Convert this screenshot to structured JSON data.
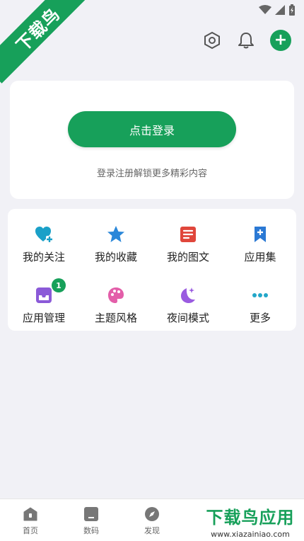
{
  "watermark": {
    "corner_text": "下载鸟",
    "logo_title": "下载鸟应用",
    "logo_url": "www.xiazainiao.com"
  },
  "login": {
    "button_label": "点击登录",
    "hint": "登录注册解锁更多精彩内容"
  },
  "menu": [
    {
      "label": "我的关注",
      "icon": "heart-plus-icon",
      "color": "#1aa0c8"
    },
    {
      "label": "我的收藏",
      "icon": "star-icon",
      "color": "#2a87d9"
    },
    {
      "label": "我的图文",
      "icon": "document-icon",
      "color": "#e0463b"
    },
    {
      "label": "应用集",
      "icon": "bookmark-plus-icon",
      "color": "#2b79d4"
    },
    {
      "label": "应用管理",
      "icon": "tray-icon",
      "color": "#8b5ad8",
      "badge": "1"
    },
    {
      "label": "主题风格",
      "icon": "palette-icon",
      "color": "#e35ea9"
    },
    {
      "label": "夜间模式",
      "icon": "moon-icon",
      "color": "#9a5be0"
    },
    {
      "label": "更多",
      "icon": "more-dots-icon",
      "color": "#23a7c9"
    }
  ],
  "bottom_nav": [
    {
      "label": "首页",
      "icon": "home-icon"
    },
    {
      "label": "数码",
      "icon": "device-icon"
    },
    {
      "label": "发现",
      "icon": "compass-icon"
    }
  ],
  "colors": {
    "accent": "#17a05a",
    "background": "#f1f1f6"
  }
}
